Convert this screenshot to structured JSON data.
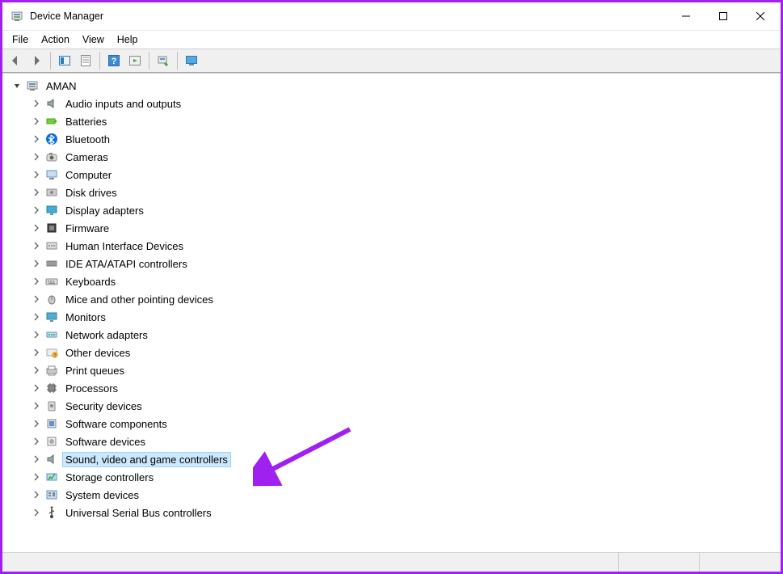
{
  "title": "Device Manager",
  "menu": {
    "file": "File",
    "action": "Action",
    "view": "View",
    "help": "Help"
  },
  "root": "AMAN",
  "categories": [
    {
      "key": "audio",
      "label": "Audio inputs and outputs"
    },
    {
      "key": "batteries",
      "label": "Batteries"
    },
    {
      "key": "bluetooth",
      "label": "Bluetooth"
    },
    {
      "key": "cameras",
      "label": "Cameras"
    },
    {
      "key": "computer",
      "label": "Computer"
    },
    {
      "key": "diskdrives",
      "label": "Disk drives"
    },
    {
      "key": "display",
      "label": "Display adapters"
    },
    {
      "key": "firmware",
      "label": "Firmware"
    },
    {
      "key": "hid",
      "label": "Human Interface Devices"
    },
    {
      "key": "ide",
      "label": "IDE ATA/ATAPI controllers"
    },
    {
      "key": "keyboards",
      "label": "Keyboards"
    },
    {
      "key": "mice",
      "label": "Mice and other pointing devices"
    },
    {
      "key": "monitors",
      "label": "Monitors"
    },
    {
      "key": "network",
      "label": "Network adapters"
    },
    {
      "key": "other",
      "label": "Other devices"
    },
    {
      "key": "printqueues",
      "label": "Print queues"
    },
    {
      "key": "processors",
      "label": "Processors"
    },
    {
      "key": "security",
      "label": "Security devices"
    },
    {
      "key": "swcomp",
      "label": "Software components"
    },
    {
      "key": "swdev",
      "label": "Software devices"
    },
    {
      "key": "sound",
      "label": "Sound, video and game controllers",
      "selected": true
    },
    {
      "key": "storage",
      "label": "Storage controllers"
    },
    {
      "key": "system",
      "label": "System devices"
    },
    {
      "key": "usb",
      "label": "Universal Serial Bus controllers"
    }
  ],
  "colors": {
    "selection_bg": "#cce8ff",
    "selection_border": "#99d1ff",
    "annotation": "#a020f0"
  }
}
